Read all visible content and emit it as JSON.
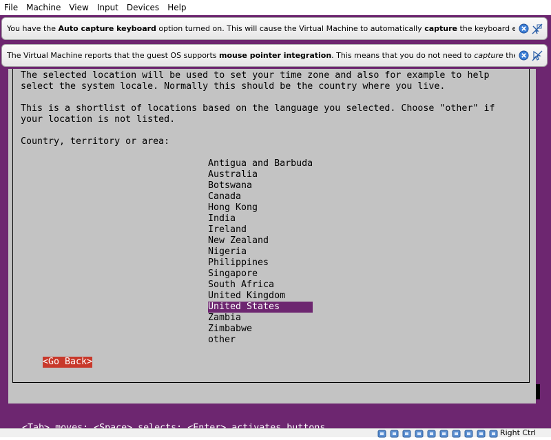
{
  "menu": {
    "items": [
      "File",
      "Machine",
      "View",
      "Input",
      "Devices",
      "Help"
    ]
  },
  "notices": {
    "keyboard": {
      "pre": "You have the ",
      "bold1": "Auto capture keyboard",
      "mid": " option turned on. This will cause the Virtual Machine to automatically ",
      "bold2": "capture",
      "post": " the keyboard every time the VM"
    },
    "mouse": {
      "pre": "The Virtual Machine reports that the guest OS supports ",
      "bold1": "mouse pointer integration",
      "mid": ". This means that you do not need to ",
      "italic": "capture",
      "post": " the mouse pointer"
    }
  },
  "installer": {
    "para1_line1": "The selected location will be used to set your time zone and also for example to help",
    "para1_line2": "select the system locale. Normally this should be the country where you live.",
    "para2_line1": "This is a shortlist of locations based on the language you selected. Choose \"other\" if",
    "para2_line2": "your location is not listed.",
    "prompt": "Country, territory or area:",
    "countries": [
      "Antigua and Barbuda",
      "Australia",
      "Botswana",
      "Canada",
      "Hong Kong",
      "India",
      "Ireland",
      "New Zealand",
      "Nigeria",
      "Philippines",
      "Singapore",
      "South Africa",
      "United Kingdom",
      "United States",
      "Zambia",
      "Zimbabwe",
      "other"
    ],
    "selected_index": 13,
    "go_back": "<Go Back>"
  },
  "hint": "<Tab> moves; <Space> selects; <Enter> activates buttons",
  "status": {
    "host_key": "Right Ctrl",
    "icons": [
      "hard-disk-icon",
      "optical-drive-icon",
      "network-icon",
      "usb-icon",
      "shared-folders-icon",
      "display-icon",
      "video-capture-icon",
      "cpu-icon",
      "mouse-integration-icon",
      "keyboard-capture-icon"
    ]
  },
  "colors": {
    "accent": "#6d2670",
    "dialog": "#c3c3c3",
    "button_active": "#c8392b"
  }
}
